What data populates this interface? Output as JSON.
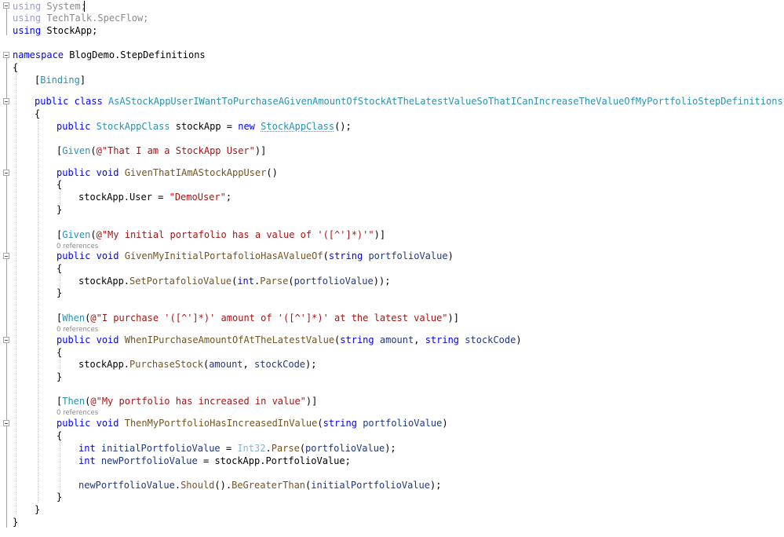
{
  "editor": {
    "using_keyword": "using",
    "namespaces_used": [
      "System",
      "TechTalk.SpecFlow",
      "StockApp"
    ],
    "namespace_keyword": "namespace",
    "namespace_name": "BlogDemo.StepDefinitions",
    "binding_attr": "Binding",
    "class_modifiers": "public class",
    "class_name": "AsAStockAppUserIWantToPurchaseAGivenAmountOfStockAtTheLatestValueSoThatICanIncreaseTheValueOfMyPortfolioStepDefinitions",
    "field": {
      "public_kw": "public",
      "type": "StockAppClass",
      "name": "stockApp",
      "new_kw": "new",
      "ctor": "StockAppClass"
    },
    "codelens": "0 references",
    "steps": [
      {
        "attr": "Given",
        "pattern": "@\"That I am a StockApp User\"",
        "method": "GivenThatIAmAStockAppUser",
        "params": "",
        "body": [
          "stockApp.User = \"DemoUser\";"
        ]
      },
      {
        "attr": "Given",
        "pattern": "@\"My initial portafolio has a value of '([^']*)'\"",
        "method": "GivenMyInitialPortafolioHasAValueOf",
        "params": "string portfolioValue",
        "body": [
          "stockApp.SetPortafolioValue(int.Parse(portfolioValue));"
        ]
      },
      {
        "attr": "When",
        "pattern": "@\"I purchase '([^']*)' amount of '([^']*)' at the latest value\"",
        "method": "WhenIPurchaseAmountOfAtTheLatestValue",
        "params": "string amount, string stockCode",
        "body": [
          "stockApp.PurchaseStock(amount, stockCode);"
        ]
      },
      {
        "attr": "Then",
        "pattern": "@\"My portfolio has increased in value\"",
        "method": "ThenMyPortfolioHasIncreasedInValue",
        "params": "string portfolioValue",
        "body": [
          "int initialPortfolioValue = Int32.Parse(portfolioValue);",
          "int newPortfolioValue = stockApp.PortfolioValue;",
          "newPortfolioValue.Should().BeGreaterThan(initialPortfolioValue);"
        ]
      }
    ]
  },
  "tokens": {
    "l1_kw": "using",
    "l1_ns": "System;",
    "l2_kw": "using",
    "l2_ns": "TechTalk.SpecFlow;",
    "l3_kw": "using",
    "l3_ns": "StockApp;",
    "l5_kw": "namespace",
    "l5_ns": "BlogDemo.StepDefinitions",
    "brace_open": "{",
    "brace_close": "}",
    "binding_open": "[",
    "binding_name": "Binding",
    "binding_close": "]",
    "public": "public",
    "class": "class",
    "void": "void",
    "new": "new",
    "string": "string",
    "int": "int",
    "class_name": "AsAStockAppUserIWantToPurchaseAGivenAmountOfStockAtTheLatestValueSoThatICanIncreaseTheValueOfMyPortfolioStepDefinitions",
    "field_type": "StockAppClass",
    "field_name": " stockApp = ",
    "ctor_type": "StockAppClass",
    "ctor_tail": "();",
    "given": "Given",
    "when": "When",
    "then": "Then",
    "attr_open": "[",
    "paren_open": "(",
    "attr_close": ")]",
    "s1_pattern": "@\"That I am a StockApp User\"",
    "s1_method": "GivenThatIAmAStockAppUser",
    "empty_params": "()",
    "s1_body_a": "stockApp.User = ",
    "s1_body_str": "\"DemoUser\"",
    "semi": ";",
    "s2_pattern": "@\"My initial portafolio has a value of '([^']*)'\"",
    "s2_method": "GivenMyInitialPortafolioHasAValueOf",
    "portfolioValue": "portfolioValue",
    "close_paren": ")",
    "s2_body_obj": "stockApp.",
    "s2_body_m": "SetPortafolioValue",
    "s2_body_int": "int",
    "dot": ".",
    "parse": "Parse",
    "s2_body_tail": "));",
    "s3_pattern": "@\"I purchase '([^']*)' amount of '([^']*)' at the latest value\"",
    "s3_method": "WhenIPurchaseAmountOfAtTheLatestValue",
    "amount": "amount",
    "comma_sp": ", ",
    "stockCode": "stockCode",
    "s3_body_obj": "stockApp.",
    "s3_body_m": "PurchaseStock",
    "s3_body_tail": ");",
    "s4_pattern": "@\"My portfolio has increased in value\"",
    "s4_method": "ThenMyPortfolioHasIncreasedInValue",
    "initialPortfolioValue": "initialPortfolioValue",
    "eq": " = ",
    "int32": "Int32",
    "newPortfolioValue": "newPortfolioValue",
    "s4_b2_tail": "stockApp.PortfolioValue;",
    "should": "Should",
    "should_paren": "().",
    "greater": "BeGreaterThan",
    "s4_b3_tail": ");",
    "codelens": "0 references"
  }
}
